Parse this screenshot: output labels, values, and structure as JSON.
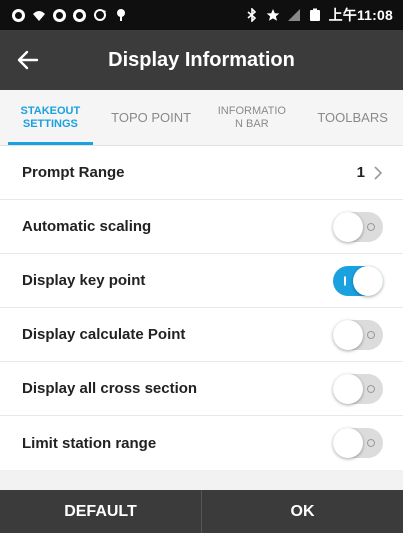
{
  "status_bar": {
    "time": "上午11:08",
    "icons_left": [
      "notification-icon",
      "signal-wifi-icon",
      "notification-icon",
      "notification-icon",
      "sync-icon",
      "location-pin-icon"
    ],
    "icons_right": [
      "bluetooth-icon",
      "star-icon",
      "cellular-signal-icon",
      "battery-icon"
    ]
  },
  "app_bar": {
    "title": "Display Information",
    "back_icon": "arrow-left-icon"
  },
  "tabs": [
    {
      "label": "STAKEOUT\nSETTINGS",
      "active": true
    },
    {
      "label": "TOPO POINT",
      "active": false
    },
    {
      "label": "INFORMATIO\nN BAR",
      "active": false
    },
    {
      "label": "TOOLBARS",
      "active": false
    }
  ],
  "settings": {
    "prompt_range": {
      "label": "Prompt Range",
      "value": "1"
    },
    "toggles": [
      {
        "label": "Automatic scaling",
        "on": false
      },
      {
        "label": "Display key point",
        "on": true
      },
      {
        "label": "Display calculate Point",
        "on": false
      },
      {
        "label": "Display all cross section",
        "on": false
      },
      {
        "label": "Limit station range",
        "on": false
      }
    ]
  },
  "bottom": {
    "default_label": "DEFAULT",
    "ok_label": "OK"
  },
  "colors": {
    "accent": "#1aa1e0",
    "app_bar": "#3b3b3b",
    "status_bar": "#0f0f0f"
  }
}
